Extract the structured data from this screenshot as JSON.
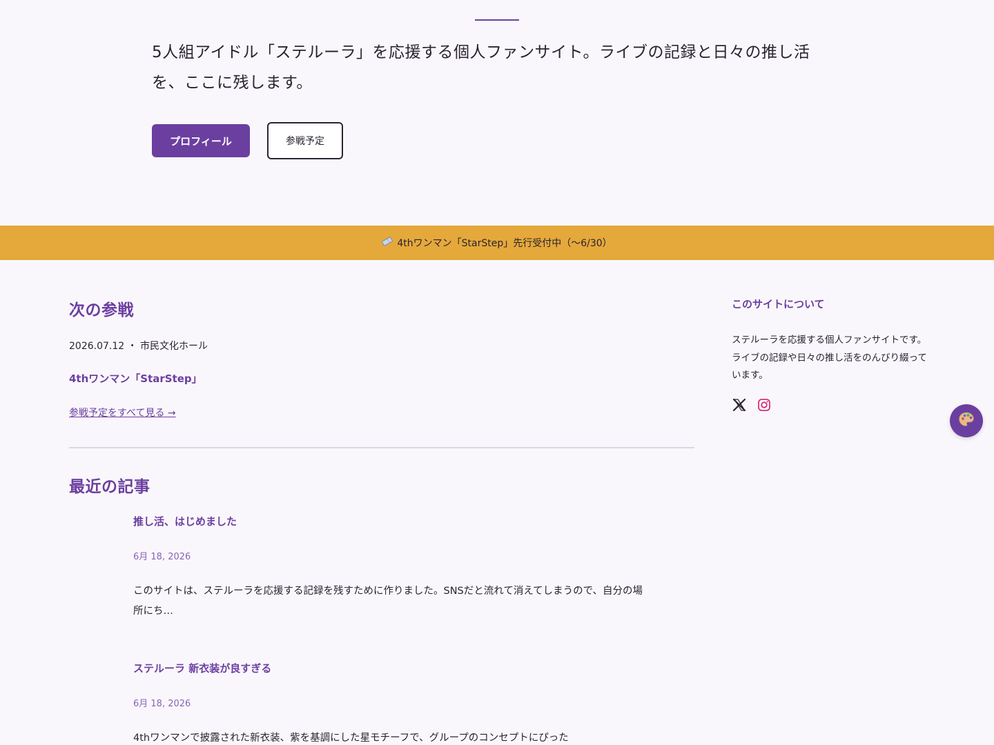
{
  "hero": {
    "description": "5人組アイドル「ステルーラ」を応援する個人ファンサイト。ライブの記録と日々の推し活を、ここに残します。",
    "primary_button": "プロフィール",
    "secondary_button": "参戦予定"
  },
  "banner": {
    "icon": "ticket-icon",
    "text": "4thワンマン「StarStep」先行受付中（〜6/30）"
  },
  "next_event": {
    "heading": "次の参戦",
    "meta": "2026.07.12 ・ 市民文化ホール",
    "title": "4thワンマン「StarStep」",
    "link": "参戦予定をすべて見る →"
  },
  "recent": {
    "heading": "最近の記事",
    "posts": [
      {
        "title": "推し活、はじめました",
        "date": "6月 18, 2026",
        "excerpt": "このサイトは、ステルーラを応援する記録を残すために作りました。SNSだと流れて消えてしまうので、自分の場所にち…"
      },
      {
        "title": "ステルーラ 新衣装が良すぎる",
        "date": "6月 18, 2026",
        "excerpt": "4thワンマンで披露された新衣装、紫を基調にした星モチーフで、グループのコンセプトにぴった"
      }
    ]
  },
  "sidebar": {
    "heading": "このサイトについて",
    "text": "ステルーラを応援する個人ファンサイトです。ライブの記録や日々の推し活をのんびり綴っています。",
    "social": [
      "x-icon",
      "instagram-icon"
    ]
  },
  "colors": {
    "accent": "#6b3fa0",
    "banner": "#e5a83b",
    "background": "#faf7fc",
    "instagram": "#d6317a"
  }
}
